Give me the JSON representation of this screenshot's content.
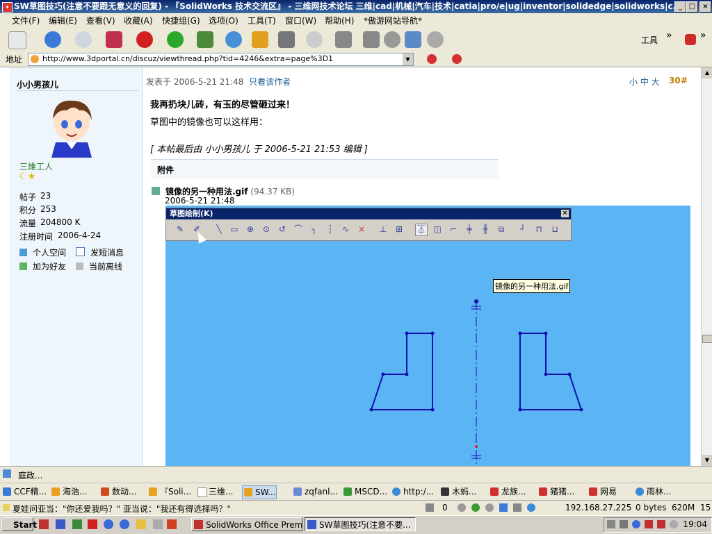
{
  "window": {
    "title": "SW草图技巧(注意不要跟无意义的回复) - 『SolidWorks 技术交流区』 - 三维网技术论坛 三维|cad|机械|汽车|技术|catia|pro/e|ug|inventor|solidedge|solidworks|c...",
    "buttons": [
      "_",
      "□",
      "×"
    ]
  },
  "menu": [
    "文件(F)",
    "编辑(E)",
    "查看(V)",
    "收藏(A)",
    "快捷组(G)",
    "选项(O)",
    "工具(T)",
    "窗口(W)",
    "帮助(H)",
    "*傲游网站导航*"
  ],
  "toolbar": {
    "tools_label": "工具",
    "more": "»"
  },
  "address": {
    "label": "地址",
    "url": "http://www.3dportal.cn/discuz/viewthread.php?tid=4246&extra=page%3D1"
  },
  "user": {
    "name": "小小男孩儿",
    "rank": "三維工人",
    "stars": "☾★",
    "stats": [
      {
        "label": "帖子",
        "value": "23"
      },
      {
        "label": "积分",
        "value": "253"
      },
      {
        "label": "流量",
        "value": "204800 K"
      },
      {
        "label": "注册时间",
        "value": "2006-4-24"
      }
    ],
    "links": [
      "个人空间",
      "发短消息",
      "加为好友",
      "当前离线"
    ]
  },
  "post": {
    "posted_label": "发表于",
    "posted_at": "2006-5-21 21:48",
    "author_only": "只看该作者",
    "sizes": "小 中 大",
    "floor": "30#",
    "title": "我再扔块儿砖，有玉的尽管砸过来！",
    "body": "草图中的镜像也可以这样用：",
    "edited": "[ 本帖最后由 小小男孩儿 于 2006-5-21 21:53 编辑 ]",
    "attachments_heading": "附件",
    "attachment": {
      "name": "镜像的另一种用法.gif",
      "size": "(94.37 KB)",
      "date": "2006-5-21 21:48"
    }
  },
  "embedded": {
    "toolbar_title": "草图绘制(K)",
    "tooltip": "镜像的另一种用法.gif"
  },
  "strip": {
    "item": "庭政..."
  },
  "tabs": [
    "CCF精...",
    "海浩...",
    "数动...",
    "『Soli...",
    "三维...",
    "SW...",
    "zqfanl...",
    "MSCD...",
    "http:/...",
    "木蚂...",
    "龙族...",
    "猪猪...",
    "网易",
    "雨林..."
  ],
  "status": {
    "message": "夏娃问亚当：\"你还爱我吗？\" 亚当说：\"我还有得选择吗？\"",
    "zero": "0",
    "ip": "192.168.27.225",
    "bytes": "0 bytes",
    "mem": "620M",
    "num": "15"
  },
  "taskbar": {
    "start": "Start",
    "tasks": [
      "SolidWorks Office Premiu...",
      "SW草图技巧(注意不要..."
    ],
    "clock": "19:04"
  }
}
